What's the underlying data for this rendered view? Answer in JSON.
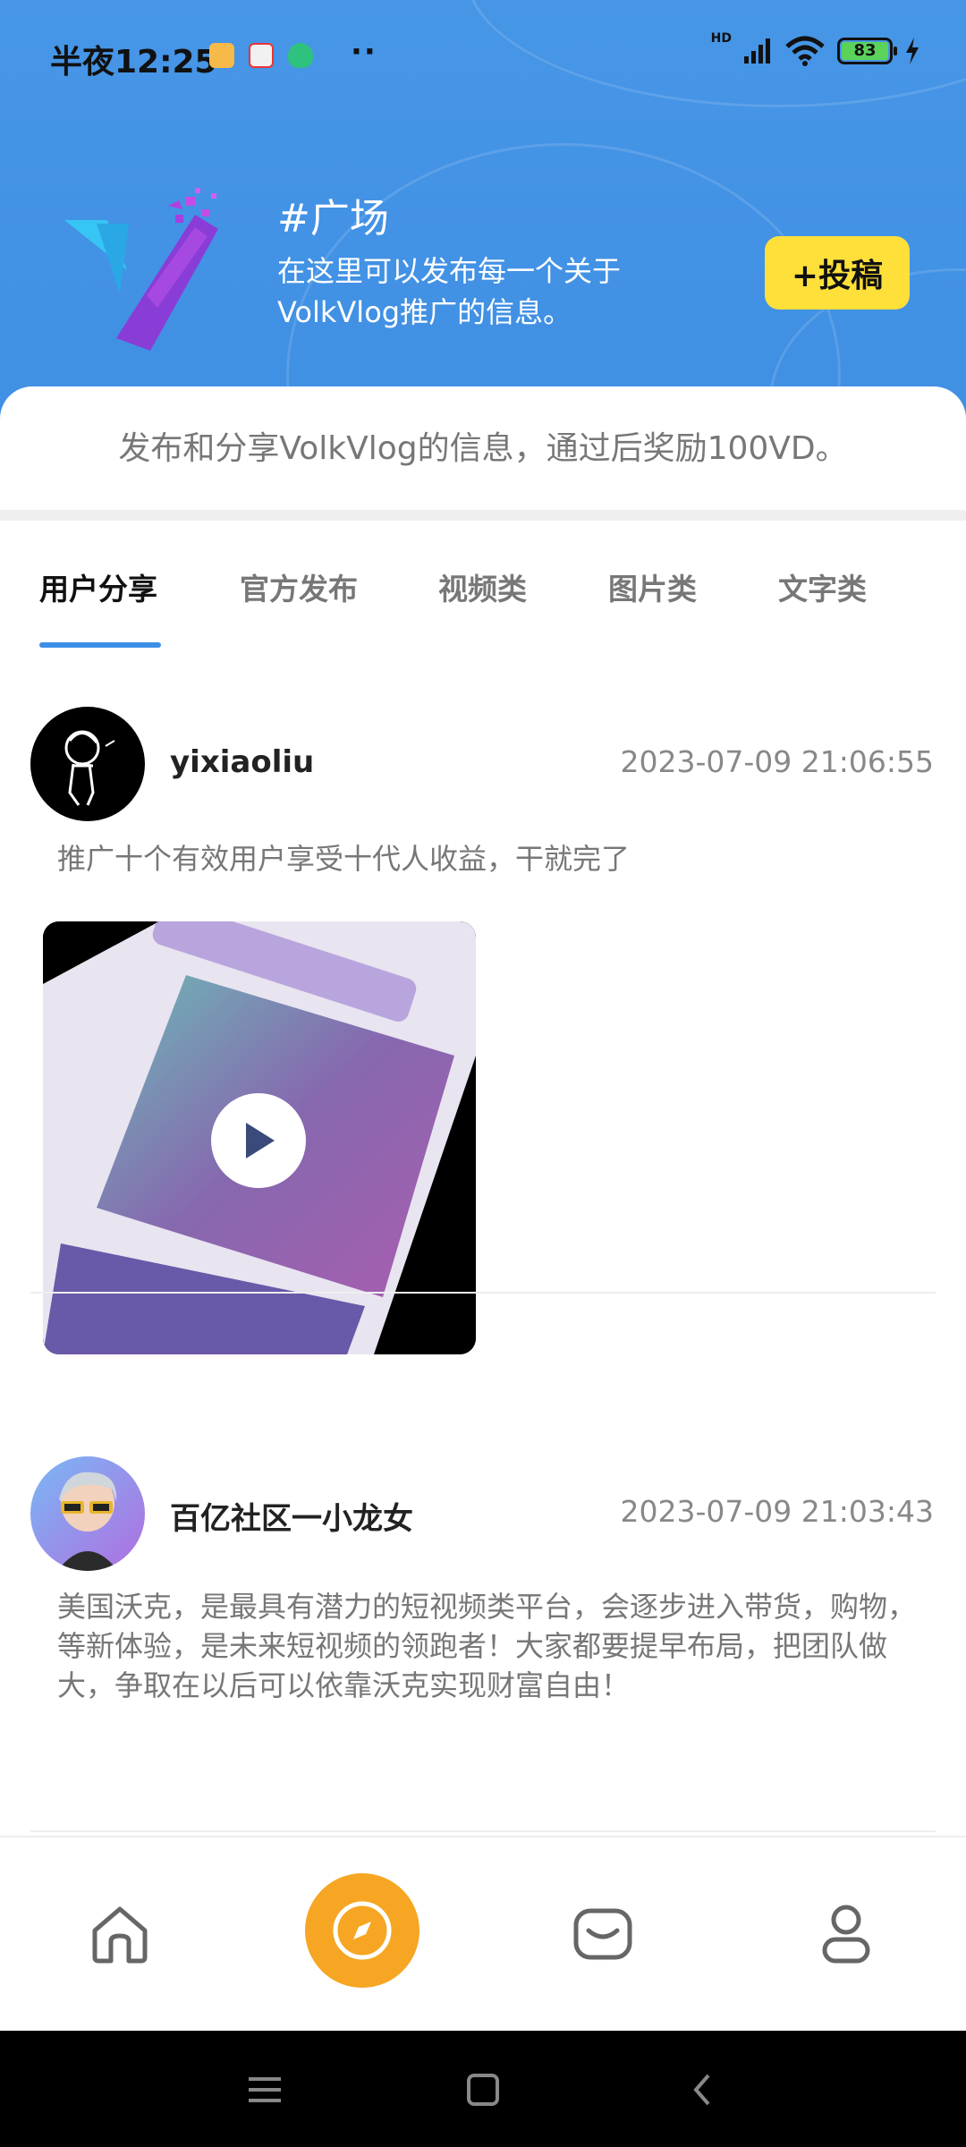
{
  "status_bar": {
    "time": "半夜12:25",
    "dots": "··",
    "network": "HD",
    "battery": "83"
  },
  "header": {
    "topic_title": "#广场",
    "topic_desc": "在这里可以发布每一个关于VolkVlog推广的信息。",
    "post_button": "+投稿"
  },
  "notice": "发布和分享VolkVlog的信息，通过后奖励100VD。",
  "tabs": [
    {
      "label": "用户分享",
      "active": true
    },
    {
      "label": "官方发布",
      "active": false
    },
    {
      "label": "视频类",
      "active": false
    },
    {
      "label": "图片类",
      "active": false
    },
    {
      "label": "文字类",
      "active": false
    }
  ],
  "posts": [
    {
      "username": "yixiaoliu",
      "time": "2023-07-09 21:06:55",
      "text": "推广十个有效用户享受十代人收益，干就完了",
      "has_video": true
    },
    {
      "username": "百亿社区一小龙女",
      "time": "2023-07-09 21:03:43",
      "text": "美国沃克，是最具有潜力的短视频类平台，会逐步进入带货，购物，等新体验，是未来短视频的领跑者！大家都要提早布局，把团队做大，争取在以后可以依靠沃克实现财富自由！",
      "has_video": false
    }
  ],
  "bottom_nav": {
    "items": [
      "home-icon",
      "compass-icon",
      "message-icon",
      "profile-icon"
    ],
    "active": "compass-icon",
    "active_color": "#f6a623"
  },
  "colors": {
    "header_blue": "#4796e6",
    "accent_yellow": "#ffe03a",
    "tab_indicator": "#3d8fe6"
  }
}
